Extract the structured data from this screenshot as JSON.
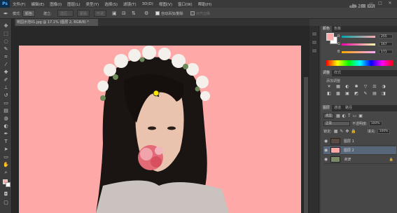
{
  "app": {
    "logo": "Ps"
  },
  "menu": [
    "文件(F)",
    "编辑(E)",
    "图像(I)",
    "图层(L)",
    "类型(Y)",
    "选择(S)",
    "滤镜(T)",
    "3D(D)",
    "视图(V)",
    "窗口(W)",
    "帮助(H)"
  ],
  "window_controls": [
    "—",
    "□",
    "✕"
  ],
  "watermark": "虎课网",
  "options": {
    "tool_icon": "brush-icon",
    "mode_label": "模式:",
    "mode_value": "颜色",
    "option_btn1": "建立:",
    "option_btn2": "选区...",
    "option_btn3": "蒙版",
    "option_btn4": "形状",
    "auto_add_delete": "自动添加/删除",
    "align_edges": "对齐边缘"
  },
  "document": {
    "tab_title": "校园示范01.jpg @ 17.1% (图层 2, RGB/8) *"
  },
  "color_panel": {
    "tabs": [
      "颜色",
      "色板"
    ],
    "foreground": "#ffabab",
    "background": "#ffffff",
    "channels": [
      {
        "label": "R",
        "value": "255"
      },
      {
        "label": "G",
        "value": "167"
      },
      {
        "label": "B",
        "value": "171"
      }
    ]
  },
  "adjustments_panel": {
    "tabs": [
      "调整",
      "样式"
    ],
    "title": "添加调整",
    "icons": [
      "☀",
      "▦",
      "◐",
      "✱",
      "▽",
      "⚖",
      "◑",
      "◧",
      "▩",
      "▣",
      "◩",
      "✎",
      "▤",
      "◨"
    ]
  },
  "layers_panel": {
    "tabs": [
      "图层",
      "通道",
      "路径"
    ],
    "kind_label": "类型",
    "blend_mode": "正常",
    "opacity_label": "不透明度:",
    "opacity_value": "100%",
    "lock_label": "锁定:",
    "fill_label": "填充:",
    "fill_value": "100%",
    "layers": [
      {
        "name": "图层 1",
        "thumb": "#5a4a44",
        "selected": false
      },
      {
        "name": "图层 2",
        "thumb": "#ffa8a8",
        "selected": true
      },
      {
        "name": "背景",
        "thumb": "#7a8a68",
        "selected": false,
        "locked": true
      }
    ]
  }
}
